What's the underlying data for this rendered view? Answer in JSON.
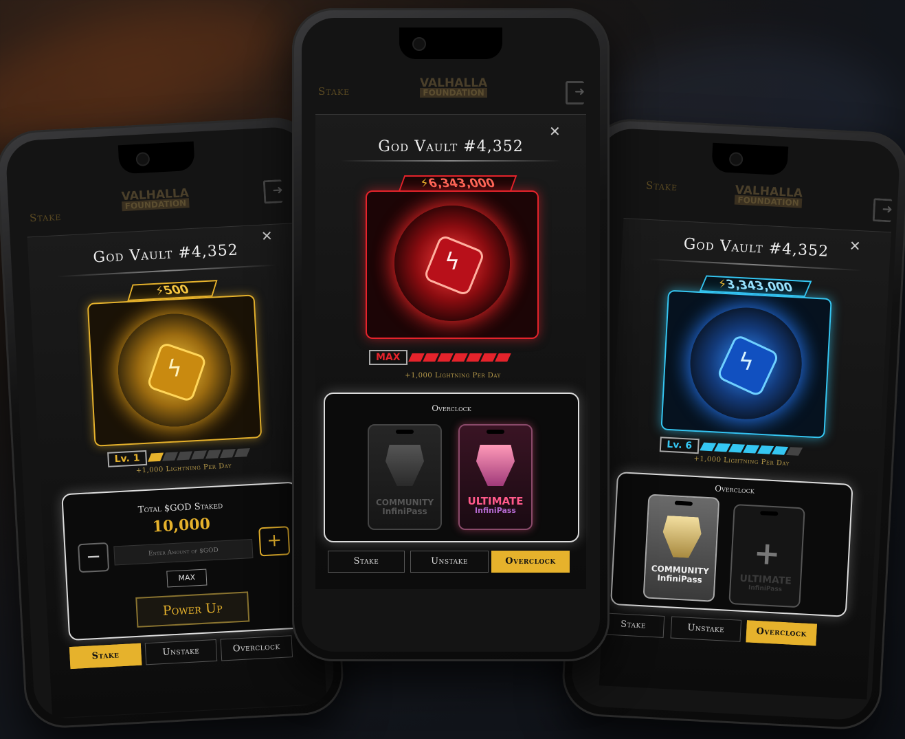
{
  "brand": {
    "line1": "VALHALLA",
    "line2": "FOUNDATION"
  },
  "header": {
    "stake_label": "Stake"
  },
  "colors": {
    "gold": "#e6b22c",
    "red": "#e5232b",
    "cyan": "#35c6f2"
  },
  "phones": [
    {
      "title": "God Vault #4,352",
      "badge_value": "500",
      "level_label": "Lv. 1",
      "per_day": "+1,000 Lightning Per Day",
      "level_fill": 0.14,
      "staked_heading": "Total $GOD Staked",
      "staked_value": "10,000",
      "amount_placeholder": "Enter Amount of $GOD",
      "minus_label": "−",
      "plus_label": "+",
      "max_label": "MAX",
      "power_up_label": "Power Up",
      "tabs": [
        "Stake",
        "Unstake",
        "Overclock"
      ],
      "active_tab": "Stake"
    },
    {
      "title": "God Vault #4,352",
      "badge_value": "6,343,000",
      "level_label": "MAX",
      "per_day": "+1,000 Lightning Per Day",
      "level_fill": 1.0,
      "panel_heading": "Overclock",
      "passes": [
        {
          "line1": "COMMUNITY",
          "line2": "InfiniPass",
          "state": "inactive"
        },
        {
          "line1": "ULTIMATE",
          "line2": "InfiniPass",
          "state": "active"
        }
      ],
      "tabs": [
        "Stake",
        "Unstake",
        "Overclock"
      ],
      "active_tab": "Overclock"
    },
    {
      "title": "God Vault #4,352",
      "badge_value": "3,343,000",
      "level_label": "Lv. 6",
      "per_day": "+1,000 Lightning Per Day",
      "level_fill": 0.86,
      "panel_heading": "Overclock",
      "passes": [
        {
          "line1": "COMMUNITY",
          "line2": "InfiniPass",
          "state": "active"
        },
        {
          "line1": "ULTIMATE",
          "line2": "InfiniPass",
          "state": "empty"
        }
      ],
      "tabs": [
        "Stake",
        "Unstake",
        "Overclock"
      ],
      "active_tab": "Overclock"
    }
  ]
}
